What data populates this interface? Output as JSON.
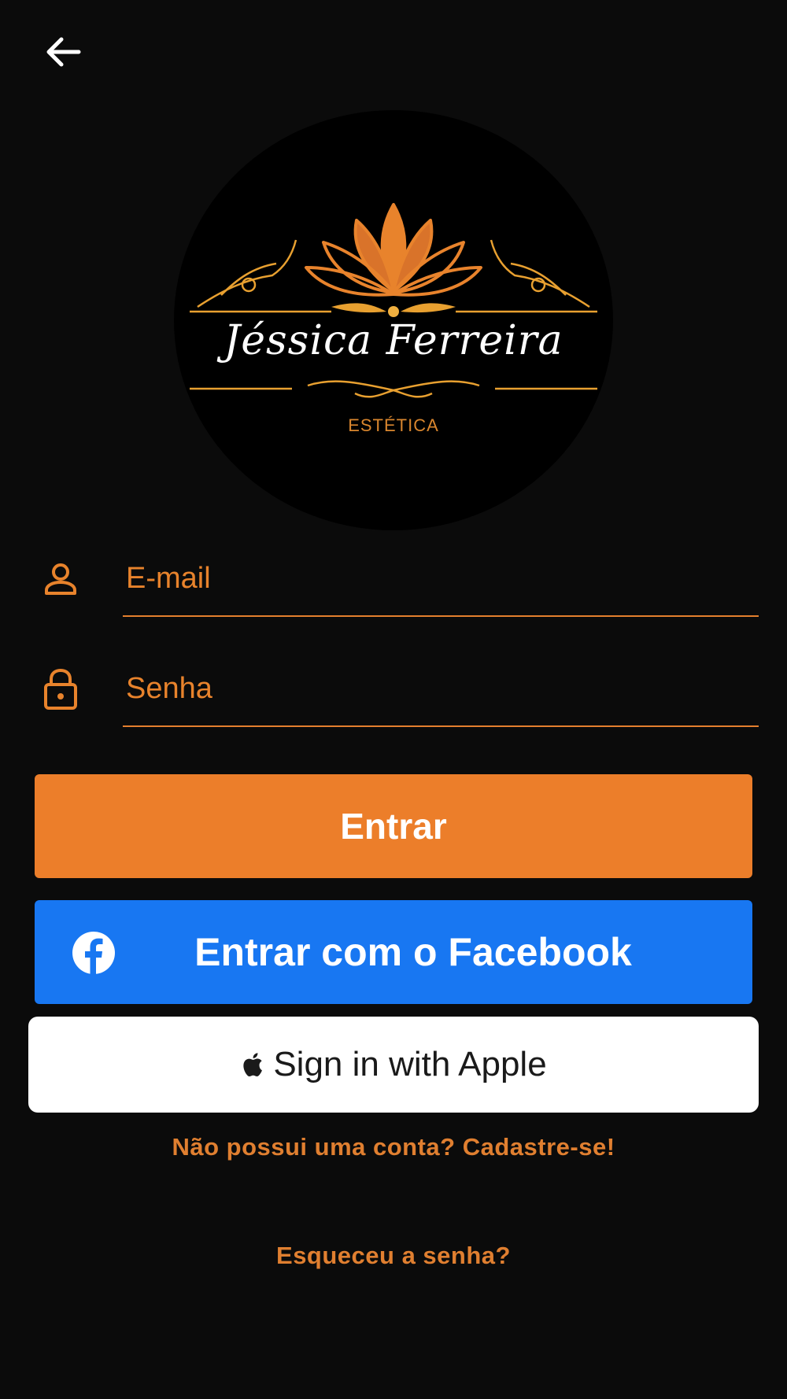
{
  "header": {
    "back_icon": "arrow-left-icon"
  },
  "logo": {
    "name": "Jéssica Ferreira",
    "subtitle": "ESTÉTICA"
  },
  "form": {
    "email": {
      "placeholder": "E-mail",
      "value": "",
      "icon": "person-icon"
    },
    "password": {
      "placeholder": "Senha",
      "value": "",
      "icon": "lock-icon"
    }
  },
  "buttons": {
    "login_label": "Entrar",
    "facebook_label": "Entrar com o Facebook",
    "apple_label": "Sign in with Apple"
  },
  "links": {
    "signup": "Não possui uma conta? Cadastre-se!",
    "forgot": "Esqueceu a senha?"
  },
  "colors": {
    "background": "#0b0b0b",
    "accent": "#ec7e2a",
    "facebook": "#1877f2",
    "apple_button": "#ffffff"
  }
}
